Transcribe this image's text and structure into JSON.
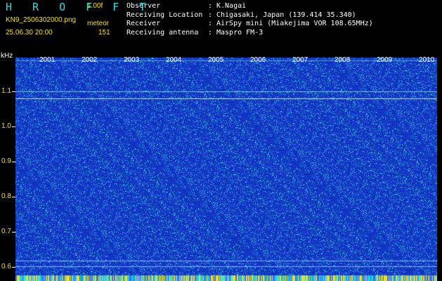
{
  "header": {
    "brand": "H R O F F T",
    "version": "1.00f",
    "filename": "KN9_2506302000.png",
    "mode": "meteor",
    "datetime": "25.06.30 20:00",
    "count": "151"
  },
  "meta": [
    {
      "label": "Observer",
      "value": "K.Nagai"
    },
    {
      "label": "Receiving Location",
      "value": "Chigasaki, Japan (139.414 35.340)"
    },
    {
      "label": "Receiver",
      "value": "AirSpy mini (Miakejima VOR 108.65MHz)"
    },
    {
      "label": "Receiving antenna",
      "value": "Maspro FM-3"
    }
  ],
  "axis": {
    "unit": "kHz",
    "y_ticks": [
      "1.1",
      "1.0",
      "0.9",
      "0.8",
      "0.7",
      "0.6"
    ],
    "x_ticks": [
      "2001",
      "2002",
      "2003",
      "2004",
      "2005",
      "2006",
      "2007",
      "2008",
      "2009",
      "2010"
    ]
  },
  "colors": {
    "background": "#000000",
    "spectrogram_base": "#1428b4",
    "speckle": "#3ed3e8",
    "label_yellow": "#f2e02a",
    "brand_cyan": "#22e0e6"
  }
}
